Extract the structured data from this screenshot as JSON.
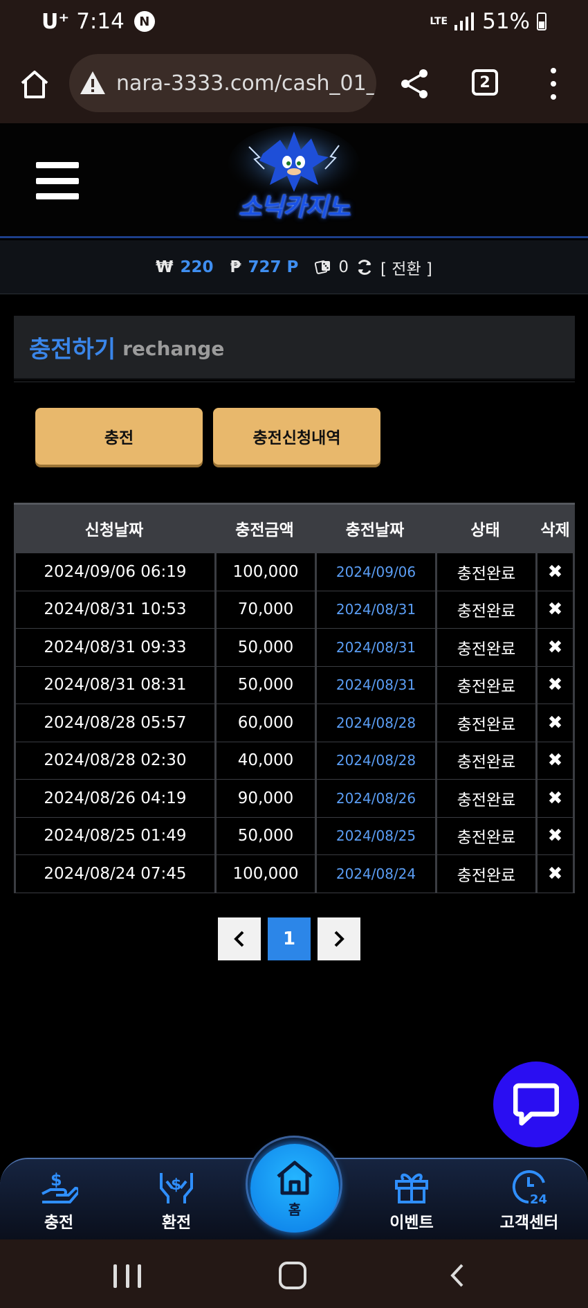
{
  "status_bar": {
    "carrier": "U⁺",
    "time": "7:14",
    "notification_badge": "N",
    "network": "LTE",
    "battery": "51%"
  },
  "browser": {
    "url": "nara-3333.com/cash_01_1.",
    "tab_count": "2"
  },
  "site": {
    "logo_text": "소닉카지노"
  },
  "balance": {
    "won_symbol": "₩",
    "won_value": "220",
    "point_symbol": "₱",
    "point_value": "727 P",
    "chip_value": "0",
    "switch_label": "[ 전환 ]"
  },
  "page": {
    "title_ko": "충전하기",
    "title_en": "rechange"
  },
  "actions": {
    "charge_label": "충전",
    "history_label": "충전신청내역"
  },
  "table": {
    "headers": [
      "신청날짜",
      "충전금액",
      "충전날짜",
      "상태",
      "삭제"
    ],
    "rows": [
      [
        "2024/09/06 06:19",
        "100,000",
        "2024/09/06",
        "충전완료"
      ],
      [
        "2024/08/31 10:53",
        "70,000",
        "2024/08/31",
        "충전완료"
      ],
      [
        "2024/08/31 09:33",
        "50,000",
        "2024/08/31",
        "충전완료"
      ],
      [
        "2024/08/31 08:31",
        "50,000",
        "2024/08/31",
        "충전완료"
      ],
      [
        "2024/08/28 05:57",
        "60,000",
        "2024/08/28",
        "충전완료"
      ],
      [
        "2024/08/28 02:30",
        "40,000",
        "2024/08/28",
        "충전완료"
      ],
      [
        "2024/08/26 04:19",
        "90,000",
        "2024/08/26",
        "충전완료"
      ],
      [
        "2024/08/25 01:49",
        "50,000",
        "2024/08/25",
        "충전완료"
      ],
      [
        "2024/08/24 07:45",
        "100,000",
        "2024/08/24",
        "충전완료"
      ]
    ],
    "delete_glyph": "✖"
  },
  "pagination": {
    "current": "1",
    "prev": "‹",
    "next": "›"
  },
  "bottom_nav": {
    "charge": "충전",
    "exchange": "환전",
    "home": "홈",
    "event": "이벤트",
    "support": "고객센터"
  },
  "colors": {
    "accent": "#3a86ea",
    "gold_button": "#e8b86c",
    "chat_fab": "#2a0ef2",
    "home_button": "#0a7be6"
  }
}
